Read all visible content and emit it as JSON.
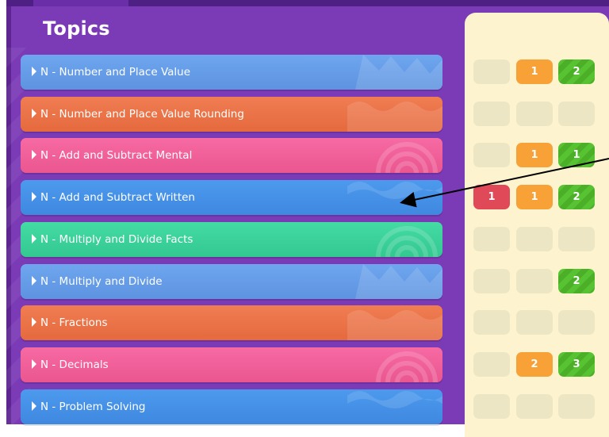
{
  "header": {
    "title": "Topics"
  },
  "topics": [
    {
      "label": "N - Number and Place Value",
      "color": "lightblue",
      "scores": [
        "",
        "1",
        "2"
      ]
    },
    {
      "label": "N - Number and Place Value Rounding",
      "color": "orange",
      "scores": [
        "",
        "",
        ""
      ]
    },
    {
      "label": "N - Add and Subtract Mental",
      "color": "pink",
      "scores": [
        "",
        "1",
        "1"
      ]
    },
    {
      "label": "N - Add and Subtract Written",
      "color": "blue",
      "scores": [
        "1",
        "1",
        "2"
      ]
    },
    {
      "label": "N - Multiply and Divide Facts",
      "color": "teal",
      "scores": [
        "",
        "",
        ""
      ]
    },
    {
      "label": "N - Multiply and Divide",
      "color": "lightblue",
      "scores": [
        "",
        "",
        "2"
      ]
    },
    {
      "label": "N - Fractions",
      "color": "orange",
      "scores": [
        "",
        "",
        ""
      ]
    },
    {
      "label": "N - Decimals",
      "color": "pink",
      "scores": [
        "",
        "2",
        "3"
      ]
    },
    {
      "label": "N - Problem Solving",
      "color": "blue",
      "scores": [
        "",
        "",
        ""
      ]
    }
  ],
  "colors": {
    "panel": "#7b3ab6",
    "score_red": "#e04958",
    "score_orange": "#f7a136",
    "score_green": "#58c332",
    "score_empty": "#ede6c4",
    "score_panel": "#fdf3cf"
  },
  "icons": {
    "row_marker": "play-triangle-icon",
    "annotation": "arrow-icon"
  }
}
